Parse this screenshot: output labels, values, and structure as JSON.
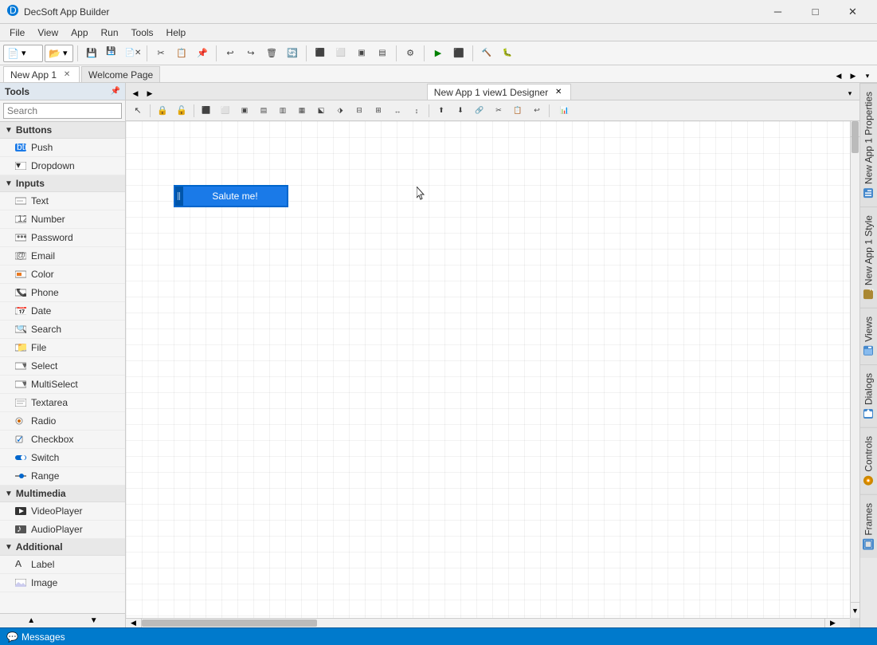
{
  "app": {
    "title": "DecSoft App Builder",
    "icon": "🔵"
  },
  "titlebar": {
    "minimize": "─",
    "restore": "□",
    "close": "✕"
  },
  "menubar": {
    "items": [
      "File",
      "View",
      "App",
      "Run",
      "Tools",
      "Help"
    ]
  },
  "toolbar": {
    "buttons": [
      {
        "name": "new-btn",
        "icon": "📄",
        "label": "New"
      },
      {
        "name": "open-btn",
        "icon": "📂",
        "label": "Open"
      },
      {
        "name": "save-btn",
        "icon": "💾",
        "label": "Save"
      },
      {
        "name": "save-all-btn",
        "icon": "💾",
        "label": "Save All"
      },
      {
        "name": "close-btn",
        "icon": "✕",
        "label": "Close"
      }
    ]
  },
  "tabs": {
    "active": "New App 1",
    "items": [
      {
        "label": "New App 1",
        "closable": true
      },
      {
        "label": "Welcome Page",
        "closable": false
      }
    ]
  },
  "tools_panel": {
    "title": "Tools",
    "search_placeholder": "Search",
    "categories": [
      {
        "name": "Buttons",
        "expanded": true,
        "items": [
          {
            "label": "Push",
            "icon": "btn"
          },
          {
            "label": "Dropdown",
            "icon": "dropdown"
          }
        ]
      },
      {
        "name": "Inputs",
        "expanded": true,
        "items": [
          {
            "label": "Text",
            "icon": "text"
          },
          {
            "label": "Number",
            "icon": "num"
          },
          {
            "label": "Password",
            "icon": "pass"
          },
          {
            "label": "Email",
            "icon": "email"
          },
          {
            "label": "Color",
            "icon": "color"
          },
          {
            "label": "Phone",
            "icon": "phone"
          },
          {
            "label": "Date",
            "icon": "date"
          },
          {
            "label": "Search",
            "icon": "search"
          },
          {
            "label": "File",
            "icon": "file"
          },
          {
            "label": "Select",
            "icon": "select"
          },
          {
            "label": "MultiSelect",
            "icon": "multisel"
          },
          {
            "label": "Textarea",
            "icon": "textarea"
          },
          {
            "label": "Radio",
            "icon": "radio"
          },
          {
            "label": "Checkbox",
            "icon": "check"
          },
          {
            "label": "Switch",
            "icon": "switch"
          },
          {
            "label": "Range",
            "icon": "range"
          }
        ]
      },
      {
        "name": "Multimedia",
        "expanded": true,
        "items": [
          {
            "label": "VideoPlayer",
            "icon": "video"
          },
          {
            "label": "AudioPlayer",
            "icon": "audio"
          }
        ]
      },
      {
        "name": "Additional",
        "expanded": true,
        "items": [
          {
            "label": "Label",
            "icon": "label"
          },
          {
            "label": "Image",
            "icon": "image"
          }
        ]
      }
    ]
  },
  "designer": {
    "tab_label": "New App 1 view1 Designer",
    "canvas_button_text": "Salute me!"
  },
  "right_tabs": [
    {
      "label": "New App 1 Properties",
      "icon": "📋"
    },
    {
      "label": "New App 1 Style",
      "icon": "🎨"
    },
    {
      "label": "Views",
      "icon": "👁"
    },
    {
      "label": "Dialogs",
      "icon": "💬"
    },
    {
      "label": "Controls",
      "icon": "🔧"
    },
    {
      "label": "Frames",
      "icon": "🖼"
    }
  ],
  "statusbar": {
    "label": "Messages"
  }
}
